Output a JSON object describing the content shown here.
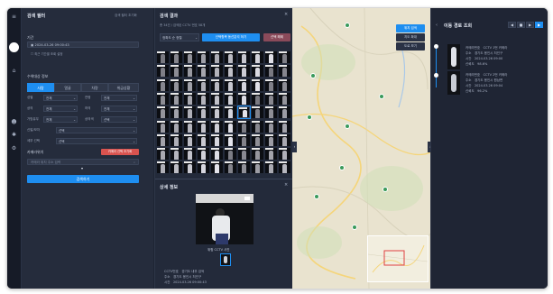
{
  "sidebar": {
    "icons": [
      "menu-icon",
      "home-icon",
      "user-icon",
      "settings-icon",
      "gear-icon"
    ]
  },
  "search": {
    "title": "검색 필터",
    "reset_label": "검색 필터 초기화",
    "period_label": "기간",
    "period_value": "2024-03-26 09:00:43",
    "period_hint": "최근 기간별 조회 설정",
    "attr_label": "수색대상 정보",
    "tabs": [
      "사람",
      "얼굴",
      "차량",
      "위급상황"
    ],
    "filters": [
      {
        "label": "성별",
        "value": "전체"
      },
      {
        "label": "연령",
        "value": "전체"
      },
      {
        "label": "상의",
        "value": "전체"
      },
      {
        "label": "하의",
        "value": "전체"
      },
      {
        "label": "가방유무",
        "value": "전체"
      },
      {
        "label": "상의색",
        "value": "선택"
      }
    ],
    "extra_rows": [
      {
        "label": "신발/모자",
        "value": "선택"
      },
      {
        "label": "세부 선택",
        "value": "선택"
      }
    ],
    "camera_label": "카메라위치",
    "camera_button": "카메라 선택 초기화",
    "address_placeholder": "카메라 위치 주소 입력",
    "search_button": "검색하기"
  },
  "results": {
    "title": "검색 결과",
    "summary": "총 34건 / 검색된 CCTV 번호 58개",
    "sort_value": "정확도 순 정렬",
    "track_button": "선택항목 동선분석 하기",
    "cancel_button": "선택 해제",
    "detail_title": "상세 정보",
    "detail_caption": "위험 CCTV 사진",
    "detail_rows": [
      {
        "key": "CCTV번호",
        "value": "경기도 내부 검색"
      },
      {
        "key": "주소",
        "value": "경기도 용인시 처인구"
      },
      {
        "key": "시간",
        "value": "2024.03.26 09:00:43"
      }
    ]
  },
  "map": {
    "buttons": [
      "위치 검색",
      "지도 확대",
      "도로 보기"
    ],
    "pins": 10
  },
  "route": {
    "title": "이동 경로 조회",
    "controls": [
      "◀",
      "■",
      "▶",
      "▶"
    ],
    "entries": [
      {
        "rows": [
          {
            "key": "카메라번호",
            "value": "CCTV 1번 카메라"
          },
          {
            "key": "주소",
            "value": "경기도 용인시 처인구"
          },
          {
            "key": "시간",
            "value": "2024.03.26 09:00"
          },
          {
            "key": "신뢰도",
            "value": "98.6%"
          }
        ]
      },
      {
        "rows": [
          {
            "key": "카메라번호",
            "value": "CCTV 2번 카메라"
          },
          {
            "key": "주소",
            "value": "경기도 용인시 원삼면"
          },
          {
            "key": "시간",
            "value": "2024.03.26 09:04"
          },
          {
            "key": "신뢰도",
            "value": "96.2%"
          }
        ]
      }
    ]
  },
  "colors": {
    "accent": "#1e8ef0",
    "danger": "#d9534f",
    "panel": "#252c3c",
    "map_bg": "#e9e3cf"
  }
}
